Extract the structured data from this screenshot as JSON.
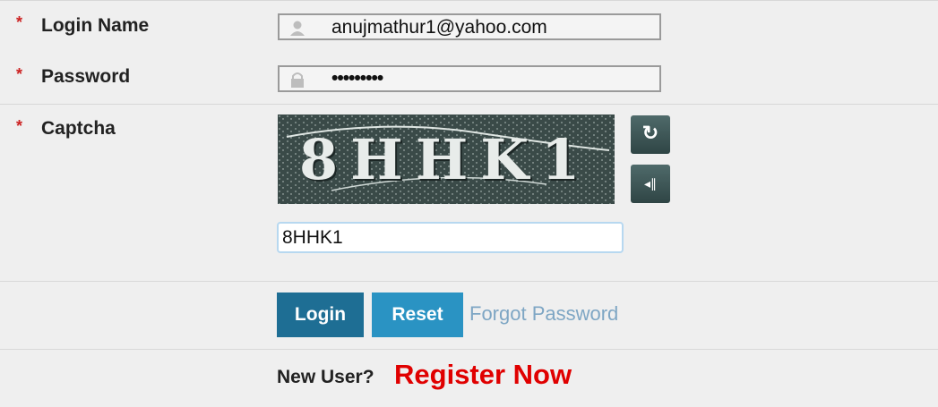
{
  "login": {
    "label": "Login Name",
    "required_mark": "*",
    "value": "anujmathur1@yahoo.com",
    "icon": "user-icon"
  },
  "password": {
    "label": "Password",
    "required_mark": "*",
    "value": "•••••••••",
    "icon": "lock-icon"
  },
  "captcha": {
    "label": "Captcha",
    "required_mark": "*",
    "image_text": "8HHK1",
    "input_value": "8HHK1",
    "refresh_icon": "↻",
    "audio_icon": "◂∥"
  },
  "buttons": {
    "login": "Login",
    "reset": "Reset",
    "forgot": "Forgot Password"
  },
  "footer": {
    "new_user": "New User?",
    "register": "Register Now"
  },
  "colors": {
    "accent": "#1e6e94",
    "reset": "#2a93c3",
    "register": "#e00000",
    "link": "#7ea6c4",
    "required": "#cc2222"
  }
}
